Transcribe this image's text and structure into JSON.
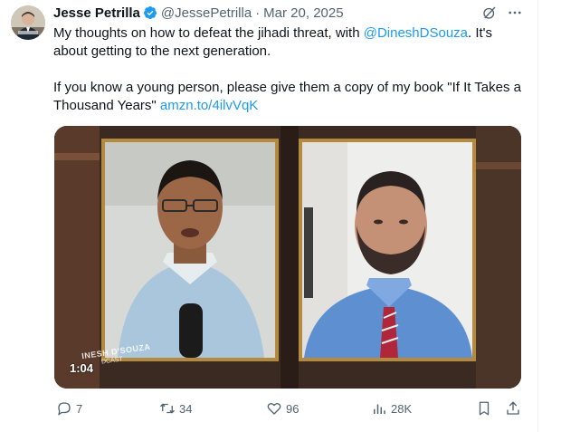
{
  "tweet": {
    "display_name": "Jesse Petrilla",
    "handle": "@JessePetrilla",
    "separator": "·",
    "date": "Mar 20, 2025",
    "text_line1_prefix": "My thoughts on how to defeat the jihadi threat, with ",
    "mention": "@DineshDSouza",
    "text_line1_suffix": ". It's about getting to the next generation.",
    "text_line2": "If you know a young person, please give them a copy of my book \"If It Takes a Thousand Years\" ",
    "link": "amzn.to/4ilvVqK"
  },
  "media": {
    "duration": "1:04",
    "watermark_line1": "INESH D'SOUZA",
    "watermark_line2": "DCAST"
  },
  "actions": {
    "replies": "7",
    "reposts": "34",
    "likes": "96",
    "views": "28K"
  },
  "colors": {
    "link": "#1d9bf0",
    "muted": "#536471",
    "verified": "#1d9bf0"
  }
}
